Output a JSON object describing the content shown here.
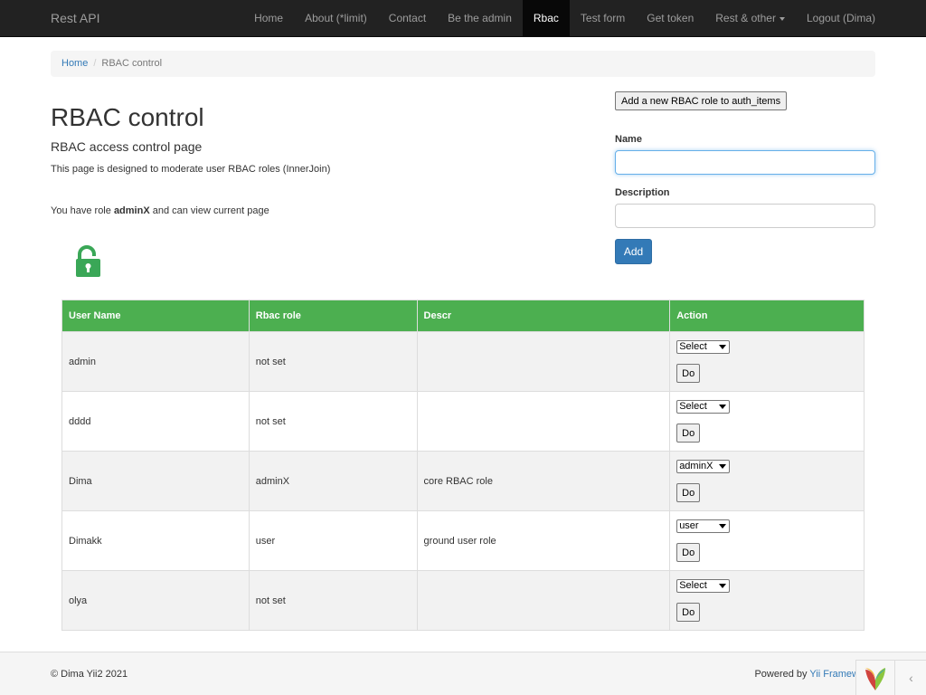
{
  "navbar": {
    "brand": "Rest API",
    "items": [
      {
        "label": "Home"
      },
      {
        "label": "About (*limit)"
      },
      {
        "label": "Contact"
      },
      {
        "label": "Be the admin"
      },
      {
        "label": "Rbac"
      },
      {
        "label": "Test form"
      },
      {
        "label": "Get token"
      },
      {
        "label": "Rest & other"
      },
      {
        "label": "Logout (Dima)"
      }
    ],
    "active": "Rbac"
  },
  "breadcrumb": {
    "home": "Home",
    "separator": "/",
    "current": "RBAC control"
  },
  "page": {
    "title": "RBAC control",
    "subtitle": "RBAC access control page",
    "description": "This page is designed to moderate user RBAC roles (InnerJoin)",
    "role_prefix": "You have role ",
    "role_name": "adminX",
    "role_suffix": " and can view current page",
    "lock_icon": "unlocked-padlock-icon",
    "lock_color": "#3aa757"
  },
  "form": {
    "add_role_button": "Add a new RBAC role to auth_items",
    "name_label": "Name",
    "name_value": "",
    "description_label": "Description",
    "description_value": "",
    "submit_label": "Add"
  },
  "table": {
    "headers": [
      "User Name",
      "Rbac role",
      "Descr",
      "Action"
    ],
    "header_color": "#4caf50",
    "rows": [
      {
        "user": "admin",
        "role": "not set",
        "descr": "",
        "select": "Select",
        "action": "Do"
      },
      {
        "user": "dddd",
        "role": "not set",
        "descr": "",
        "select": "Select",
        "action": "Do"
      },
      {
        "user": "Dima",
        "role": "adminX",
        "descr": "core RBAC role",
        "select": "adminX",
        "action": "Do"
      },
      {
        "user": "Dimakk",
        "role": "user",
        "descr": "ground user role",
        "select": "user",
        "action": "Do"
      },
      {
        "user": "olya",
        "role": "not set",
        "descr": "",
        "select": "Select",
        "action": "Do"
      }
    ]
  },
  "footer": {
    "copyright": "© Dima Yii2 2021",
    "powered_prefix": "Powered by ",
    "powered_link": "Yii Framew",
    "yii_icon": "yii-logo-icon",
    "toggle_icon": "chevron-left-icon",
    "toggle_glyph": "‹"
  }
}
